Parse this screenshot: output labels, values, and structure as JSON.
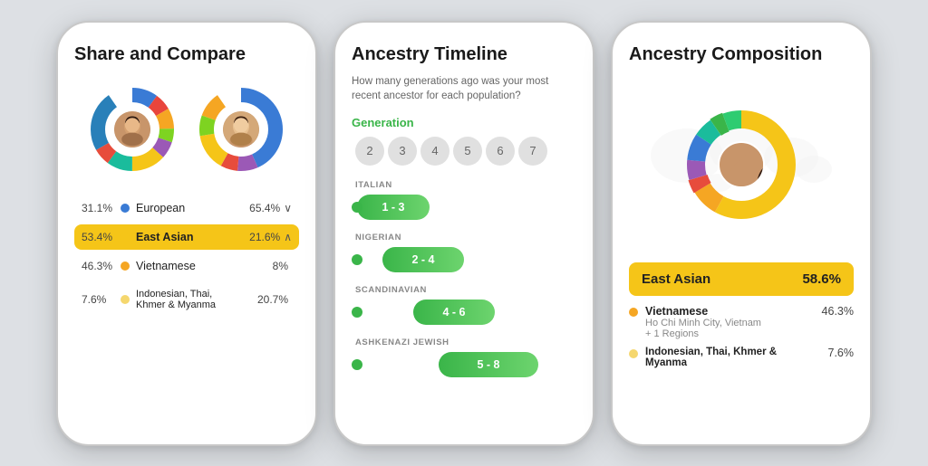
{
  "phone1": {
    "title": "Share and Compare",
    "donut1_segments": [
      {
        "color": "#3a7bd5",
        "pct": 15,
        "offset": 0
      },
      {
        "color": "#e8453c",
        "pct": 10,
        "offset": 15
      },
      {
        "color": "#f5a623",
        "pct": 12,
        "offset": 25
      },
      {
        "color": "#7ed321",
        "pct": 8,
        "offset": 37
      },
      {
        "color": "#9b59b6",
        "pct": 10,
        "offset": 45
      },
      {
        "color": "#f5c518",
        "pct": 20,
        "offset": 55
      },
      {
        "color": "#1abc9c",
        "pct": 15,
        "offset": 75
      },
      {
        "color": "#e74c3c",
        "pct": 10,
        "offset": 90
      }
    ],
    "legend_rows": [
      {
        "pct_left": "31.1%",
        "dot_color": "#3a7bd5",
        "label": "European",
        "pct_right": "65.4%",
        "chevron": "∨",
        "highlight": false
      },
      {
        "pct_left": "53.4%",
        "dot_color": "#f5c518",
        "label": "East Asian",
        "pct_right": "21.6%",
        "chevron": "∧",
        "highlight": true
      },
      {
        "pct_left": "46.3%",
        "dot_color": "#f5a623",
        "label": "Vietnamese",
        "pct_right": "8%",
        "chevron": "",
        "highlight": false
      },
      {
        "pct_left": "7.6%",
        "dot_color": "#f5d76e",
        "label": "Indonesian, Thai,\nKhmer & Myanma",
        "pct_right": "20.7%",
        "chevron": "",
        "highlight": false
      }
    ]
  },
  "phone2": {
    "title": "Ancestry Timeline",
    "subtitle": "How many generations ago was your most recent ancestor for each population?",
    "gen_label": "Generation",
    "gen_numbers": [
      "2",
      "3",
      "4",
      "5",
      "6",
      "7"
    ],
    "timeline_items": [
      {
        "category": "ITALIAN",
        "label": "1 - 3",
        "offset": 0,
        "width": 80
      },
      {
        "category": "NIGERIAN",
        "label": "2 - 4",
        "offset": 28,
        "width": 90
      },
      {
        "category": "SCANDINAVIAN",
        "label": "4 - 6",
        "offset": 62,
        "width": 90
      },
      {
        "category": "ASHKENAZI JEWISH",
        "label": "5 - 8",
        "offset": 90,
        "width": 110
      }
    ]
  },
  "phone3": {
    "title": "Ancestry Composition",
    "highlight": {
      "label": "East Asian",
      "pct": "58.6%"
    },
    "legend_rows": [
      {
        "dot_color": "#f5a623",
        "name": "Vietnamese",
        "sub1": "Ho Chi Minh City, Vietnam",
        "sub2": "+ 1 Regions",
        "pct": "46.3%"
      },
      {
        "dot_color": "#f5d76e",
        "name": "Indonesian, Thai, Khmer &\nMyanma",
        "sub1": "",
        "sub2": "",
        "pct": "7.6%"
      }
    ]
  },
  "colors": {
    "green": "#3ab549",
    "yellow": "#f5c518",
    "blue": "#3a7bd5"
  }
}
